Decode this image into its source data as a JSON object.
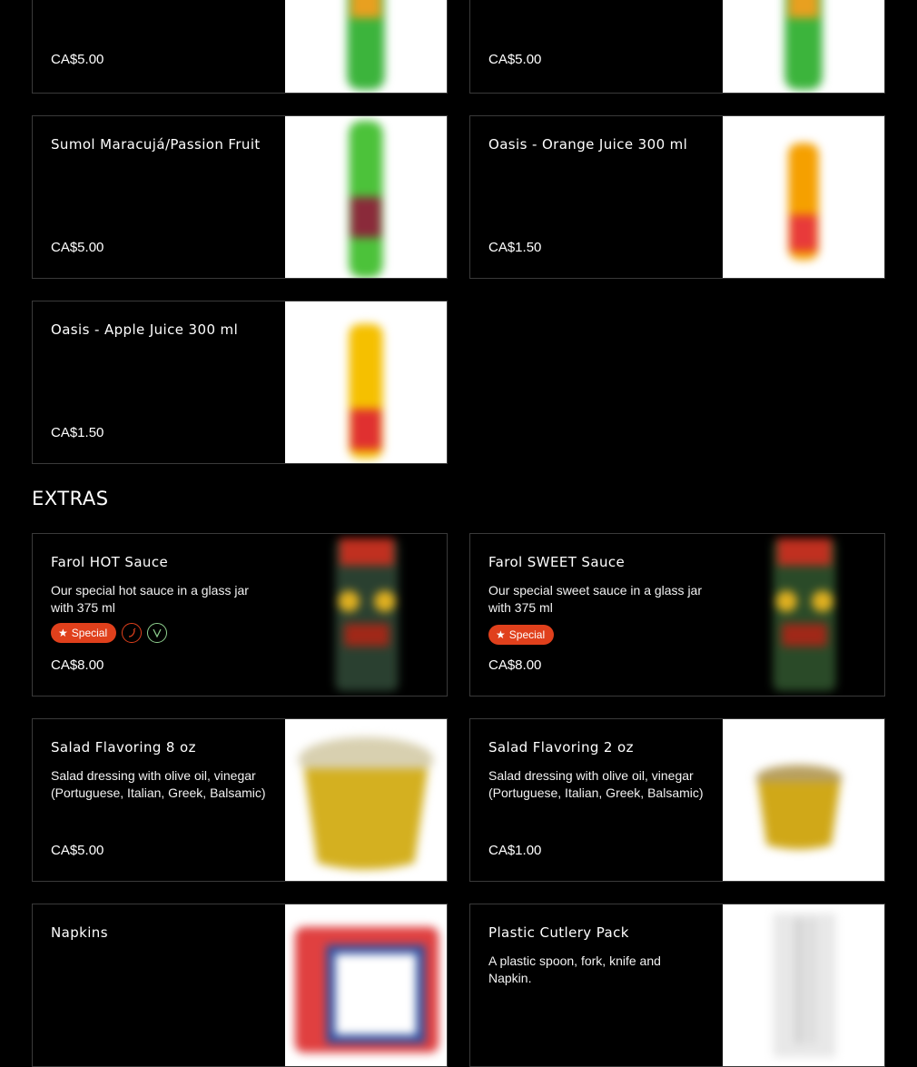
{
  "drinks": [
    {
      "title": "",
      "price": "CA$5.00"
    },
    {
      "title": "",
      "price": "CA$5.00"
    },
    {
      "title": "Sumol Maracujá/Passion Fruit",
      "price": "CA$5.00"
    },
    {
      "title": "Oasis - Orange Juice 300 ml",
      "price": "CA$1.50"
    },
    {
      "title": "Oasis - Apple Juice 300 ml",
      "price": "CA$1.50"
    }
  ],
  "extras": {
    "section_title": "EXTRAS",
    "items": [
      {
        "title": "Farol HOT Sauce",
        "desc": "Our special hot sauce in a glass jar with 375 ml",
        "badge": "Special",
        "price": "CA$8.00"
      },
      {
        "title": "Farol SWEET Sauce",
        "desc": "Our special sweet sauce in a glass jar with 375 ml",
        "badge": "Special",
        "price": "CA$8.00"
      },
      {
        "title": "Salad Flavoring 8 oz",
        "desc": "Salad dressing with olive oil, vinegar (Portuguese, Italian, Greek, Balsamic)",
        "price": "CA$5.00"
      },
      {
        "title": "Salad Flavoring 2 oz",
        "desc": "Salad dressing with olive oil, vinegar (Portuguese, Italian, Greek, Balsamic)",
        "price": "CA$1.00"
      },
      {
        "title": "Napkins",
        "desc": "",
        "price": ""
      },
      {
        "title": "Plastic Cutlery Pack",
        "desc": "A plastic spoon, fork, knife and Napkin.",
        "price": ""
      }
    ]
  },
  "icons": {
    "special": "star-icon",
    "spicy": "chili-icon",
    "vegetarian": "vegetarian-v-icon"
  },
  "colors": {
    "accent": "#e0401c",
    "vegetarian": "#8fd18f",
    "border": "#3a3a3a",
    "background": "#000000"
  }
}
